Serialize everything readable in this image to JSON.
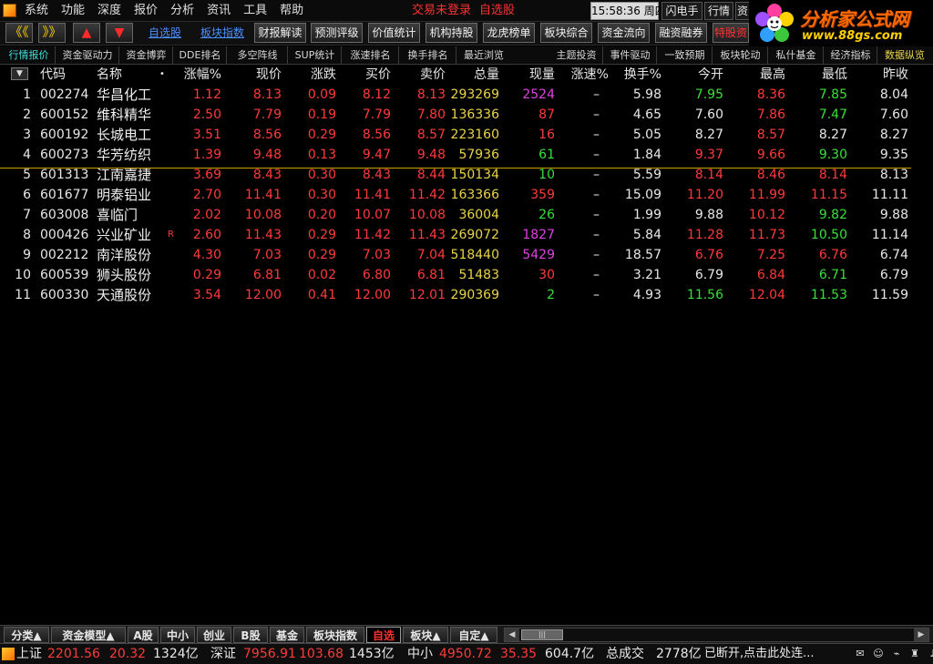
{
  "menu": [
    "系统",
    "功能",
    "深度",
    "报价",
    "分析",
    "资讯",
    "工具",
    "帮助"
  ],
  "status_notlogged": "交易未登录",
  "status_zixuan": "自选股",
  "time": "15:58:36",
  "weekday": "周四",
  "top_buttons": [
    "闪电手",
    "行情",
    "资"
  ],
  "logo": {
    "title": "分析家公式网",
    "url": "www.88gs.com"
  },
  "toolbar": {
    "nav": [
      "《《",
      "》》",
      "▲",
      "▼"
    ],
    "links": [
      "自选股",
      "板块指数"
    ],
    "buttons": [
      "财报解读",
      "预测评级",
      "价值统计",
      "机构持股",
      "龙虎榜单",
      "板块综合",
      "资金流向",
      "融资融券",
      "特股资"
    ]
  },
  "subtabs_left": [
    "行情报价",
    "资金驱动力",
    "资金博弈",
    "DDE排名",
    "多空阵线",
    "SUP统计",
    "涨速排名",
    "换手排名",
    "最近浏览"
  ],
  "subtabs_right": [
    "主题投资",
    "事件驱动",
    "一致预期",
    "板块轮动",
    "私什基金",
    "经济指标",
    "数据纵览"
  ],
  "header": {
    "sort": "▼",
    "cols": [
      "代码",
      "名称",
      "•",
      "涨幅%",
      "现价",
      "涨跌",
      "买价",
      "卖价",
      "总量",
      "现量",
      "涨速%",
      "换手%",
      "今开",
      "最高",
      "最低",
      "昨收"
    ]
  },
  "rows": [
    {
      "idx": "1",
      "code": "002274",
      "name": "华昌化工",
      "flag": "",
      "pct": "1.12",
      "price": "8.13",
      "chg": "0.09",
      "bid": "8.12",
      "ask": "8.13",
      "vol": "293269",
      "cur": "2524",
      "speed": "–",
      "turn": "5.98",
      "open": "7.95",
      "high": "8.36",
      "low": "7.85",
      "prev": "8.04",
      "colors": {
        "open": "green",
        "high": "red",
        "low": "green",
        "cur": "magenta"
      }
    },
    {
      "idx": "2",
      "code": "600152",
      "name": "维科精华",
      "flag": "",
      "pct": "2.50",
      "price": "7.79",
      "chg": "0.19",
      "bid": "7.79",
      "ask": "7.80",
      "vol": "136336",
      "cur": "87",
      "speed": "–",
      "turn": "4.65",
      "open": "7.60",
      "high": "7.86",
      "low": "7.47",
      "prev": "7.60",
      "colors": {
        "open": "white",
        "high": "red",
        "low": "green",
        "cur": "red"
      }
    },
    {
      "idx": "3",
      "code": "600192",
      "name": "长城电工",
      "flag": "",
      "pct": "3.51",
      "price": "8.56",
      "chg": "0.29",
      "bid": "8.56",
      "ask": "8.57",
      "vol": "223160",
      "cur": "16",
      "speed": "–",
      "turn": "5.05",
      "open": "8.27",
      "high": "8.57",
      "low": "8.27",
      "prev": "8.27",
      "colors": {
        "open": "white",
        "high": "red",
        "low": "white",
        "cur": "red"
      }
    },
    {
      "idx": "4",
      "code": "600273",
      "name": "华芳纺织",
      "flag": "",
      "pct": "1.39",
      "price": "9.48",
      "chg": "0.13",
      "bid": "9.47",
      "ask": "9.48",
      "vol": "57936",
      "cur": "61",
      "speed": "–",
      "turn": "1.84",
      "open": "9.37",
      "high": "9.66",
      "low": "9.30",
      "prev": "9.35",
      "colors": {
        "open": "red",
        "high": "red",
        "low": "green",
        "cur": "green"
      }
    },
    {
      "idx": "5",
      "code": "601313",
      "name": "江南嘉捷",
      "flag": "",
      "pct": "3.69",
      "price": "8.43",
      "chg": "0.30",
      "bid": "8.43",
      "ask": "8.44",
      "vol": "150134",
      "cur": "10",
      "speed": "–",
      "turn": "5.59",
      "open": "8.14",
      "high": "8.46",
      "low": "8.14",
      "prev": "8.13",
      "colors": {
        "open": "red",
        "high": "red",
        "low": "red",
        "cur": "green"
      }
    },
    {
      "idx": "6",
      "code": "601677",
      "name": "明泰铝业",
      "flag": "",
      "pct": "2.70",
      "price": "11.41",
      "chg": "0.30",
      "bid": "11.41",
      "ask": "11.42",
      "vol": "163366",
      "cur": "359",
      "speed": "–",
      "turn": "15.09",
      "open": "11.20",
      "high": "11.99",
      "low": "11.15",
      "prev": "11.11",
      "colors": {
        "open": "red",
        "high": "red",
        "low": "red",
        "cur": "red"
      }
    },
    {
      "idx": "7",
      "code": "603008",
      "name": "喜临门",
      "flag": "",
      "pct": "2.02",
      "price": "10.08",
      "chg": "0.20",
      "bid": "10.07",
      "ask": "10.08",
      "vol": "36004",
      "cur": "26",
      "speed": "–",
      "turn": "1.99",
      "open": "9.88",
      "high": "10.12",
      "low": "9.82",
      "prev": "9.88",
      "colors": {
        "open": "white",
        "high": "red",
        "low": "green",
        "cur": "green"
      }
    },
    {
      "idx": "8",
      "code": "000426",
      "name": "兴业矿业",
      "flag": "R",
      "pct": "2.60",
      "price": "11.43",
      "chg": "0.29",
      "bid": "11.42",
      "ask": "11.43",
      "vol": "269072",
      "cur": "1827",
      "speed": "–",
      "turn": "5.84",
      "open": "11.28",
      "high": "11.73",
      "low": "10.50",
      "prev": "11.14",
      "colors": {
        "open": "red",
        "high": "red",
        "low": "green",
        "cur": "magenta"
      }
    },
    {
      "idx": "9",
      "code": "002212",
      "name": "南洋股份",
      "flag": "",
      "pct": "4.30",
      "price": "7.03",
      "chg": "0.29",
      "bid": "7.03",
      "ask": "7.04",
      "vol": "518440",
      "cur": "5429",
      "speed": "–",
      "turn": "18.57",
      "open": "6.76",
      "high": "7.25",
      "low": "6.76",
      "prev": "6.74",
      "colors": {
        "open": "red",
        "high": "red",
        "low": "red",
        "cur": "magenta"
      }
    },
    {
      "idx": "10",
      "code": "600539",
      "name": "狮头股份",
      "flag": "",
      "pct": "0.29",
      "price": "6.81",
      "chg": "0.02",
      "bid": "6.80",
      "ask": "6.81",
      "vol": "51483",
      "cur": "30",
      "speed": "–",
      "turn": "3.21",
      "open": "6.79",
      "high": "6.84",
      "low": "6.71",
      "prev": "6.79",
      "colors": {
        "open": "white",
        "high": "red",
        "low": "green",
        "cur": "red"
      }
    },
    {
      "idx": "11",
      "code": "600330",
      "name": "天通股份",
      "flag": "",
      "pct": "3.54",
      "price": "12.00",
      "chg": "0.41",
      "bid": "12.00",
      "ask": "12.01",
      "vol": "290369",
      "cur": "2",
      "speed": "–",
      "turn": "4.93",
      "open": "11.56",
      "high": "12.04",
      "low": "11.53",
      "prev": "11.59",
      "colors": {
        "open": "green",
        "high": "red",
        "low": "green",
        "cur": "green"
      }
    }
  ],
  "bottom_tabs": [
    "分类▲",
    "资金模型▲",
    "A股",
    "中小",
    "创业",
    "B股",
    "基金",
    "板块指数",
    "自选",
    "板块▲",
    "自定▲"
  ],
  "scroll_thumb": "|||",
  "statusbar": {
    "sh_label": "上证",
    "sh_val": "2201.56",
    "sh_chg": "20.32",
    "sh_amt": "1324亿",
    "sz_label": "深证",
    "sz_val": "7956.91",
    "sz_chg": "103.68",
    "sz_amt": "1453亿",
    "zx_label": "中小",
    "zx_val": "4950.72",
    "zx_chg": "35.35",
    "zx_amt": "604.7亿",
    "total_label": "总成交",
    "total_val": "2778亿",
    "msg": "已断开,点击此处连..."
  },
  "colors": {
    "up": "#ff3a3a",
    "down": "#38e038",
    "volume": "#e8d34a",
    "accent": "#40e0e0"
  }
}
